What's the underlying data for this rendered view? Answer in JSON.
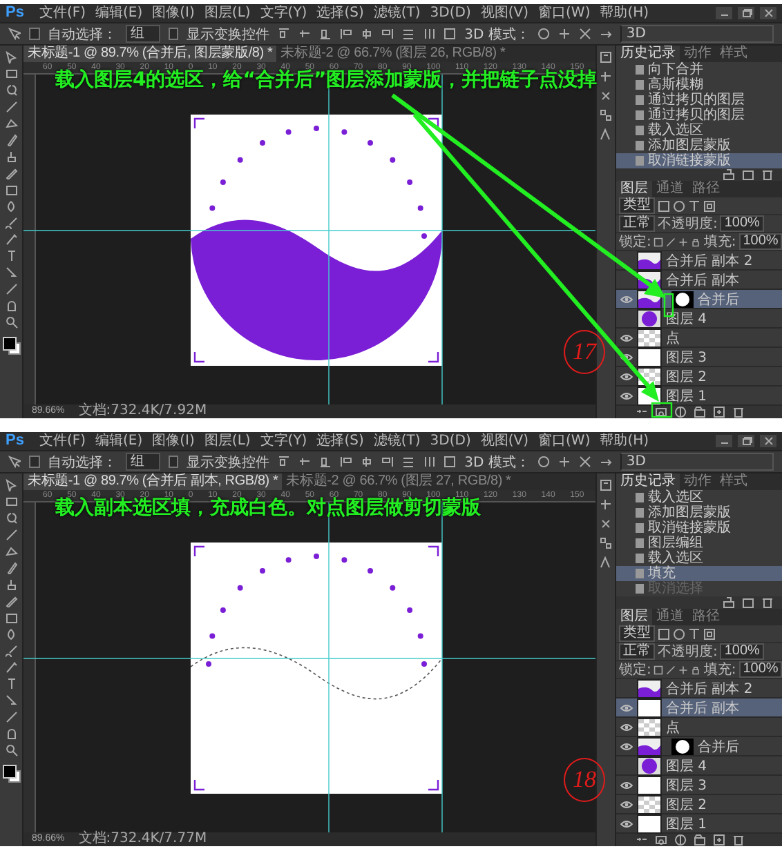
{
  "panels": [
    {
      "menu_bar": {
        "logo": "Ps",
        "items": [
          "文件(F)",
          "编辑(E)",
          "图像(I)",
          "图层(L)",
          "文字(Y)",
          "选择(S)",
          "滤镜(T)",
          "3D(D)",
          "视图(V)",
          "窗口(W)",
          "帮助(H)"
        ]
      },
      "options_bar": {
        "auto_select_label": "自动选择：",
        "auto_select_checked": false,
        "auto_select_value": "组",
        "transform_label": "显示变换控件",
        "transform_checked": false,
        "mode_label": "3D 模式：",
        "mode_value": "3D"
      },
      "document_tabs": [
        {
          "label": "未标题-1 @ 89.7% (合并后, 图层蒙版/8) *",
          "selected": true
        },
        {
          "label": "未标题-2 @ 66.7% (图层 26, RGB/8) *",
          "selected": false
        }
      ],
      "ruler_ticks": [
        "60",
        "50",
        "40",
        "30",
        "20",
        "10",
        "0",
        "10",
        "20",
        "30",
        "40",
        "50",
        "60",
        "70",
        "80",
        "90",
        "100",
        "110",
        "120",
        "130",
        "140",
        "150"
      ],
      "canvas": {
        "kind": "masked-shape"
      },
      "status_bar": {
        "zoom": "89.66%",
        "doc_size": "文档:732.4K/7.92M"
      },
      "history": {
        "tabs": [
          {
            "label": "历史记录",
            "selected": true
          },
          {
            "label": "动作",
            "selected": false
          },
          {
            "label": "样式",
            "selected": false
          }
        ],
        "items": [
          {
            "label": "向下合并",
            "selected": false,
            "disabled": false
          },
          {
            "label": "高斯模糊",
            "selected": false,
            "disabled": false
          },
          {
            "label": "通过拷贝的图层",
            "selected": false,
            "disabled": false
          },
          {
            "label": "通过拷贝的图层",
            "selected": false,
            "disabled": false
          },
          {
            "label": "载入选区",
            "selected": false,
            "disabled": false
          },
          {
            "label": "添加图层蒙版",
            "selected": false,
            "disabled": false
          },
          {
            "label": "取消链接蒙版",
            "selected": true,
            "disabled": false
          }
        ]
      },
      "layers": {
        "tabs": [
          {
            "label": "图层",
            "selected": true
          },
          {
            "label": "通道",
            "selected": false
          },
          {
            "label": "路径",
            "selected": false
          }
        ],
        "filter": "类型",
        "blend_mode": "正常",
        "opacity_label": "不透明度:",
        "opacity": "100%",
        "lock_label": "锁定:",
        "fill_label": "填充:",
        "fill": "100%",
        "items": [
          {
            "name": "合并后 副本 2",
            "kind": "wave",
            "mask": false,
            "visible": false,
            "selected": false
          },
          {
            "name": "合并后 副本",
            "kind": "wave",
            "mask": false,
            "visible": false,
            "selected": false
          },
          {
            "name": "合并后",
            "kind": "wave",
            "mask": true,
            "visible": true,
            "selected": true
          },
          {
            "name": "图层 4",
            "kind": "circle",
            "mask": false,
            "visible": false,
            "selected": false
          },
          {
            "name": "点",
            "kind": "transparent",
            "mask": false,
            "visible": true,
            "selected": false
          },
          {
            "name": "图层 3",
            "kind": "white",
            "mask": false,
            "visible": true,
            "selected": false
          },
          {
            "name": "图层 2",
            "kind": "transparent",
            "mask": false,
            "visible": true,
            "selected": false
          },
          {
            "name": "图层 1",
            "kind": "white",
            "mask": false,
            "visible": true,
            "selected": false
          }
        ]
      },
      "annotation": {
        "text": "载入图层4的选区，给“合并后”图层添加蒙版，并把链子点没掉",
        "step": "17",
        "arrows": true
      }
    },
    {
      "menu_bar": {
        "logo": "Ps",
        "items": [
          "文件(F)",
          "编辑(E)",
          "图像(I)",
          "图层(L)",
          "文字(Y)",
          "选择(S)",
          "滤镜(T)",
          "3D(D)",
          "视图(V)",
          "窗口(W)",
          "帮助(H)"
        ]
      },
      "options_bar": {
        "auto_select_label": "自动选择：",
        "auto_select_checked": false,
        "auto_select_value": "组",
        "transform_label": "显示变换控件",
        "transform_checked": false,
        "mode_label": "3D 模式：",
        "mode_value": "3D"
      },
      "document_tabs": [
        {
          "label": "未标题-1 @ 89.7% (合并后 副本, RGB/8) *",
          "selected": true
        },
        {
          "label": "未标题-2 @ 66.7% (图层 27, RGB/8) *",
          "selected": false
        }
      ],
      "ruler_ticks": [
        "60",
        "50",
        "40",
        "30",
        "20",
        "10",
        "0",
        "10",
        "20",
        "30",
        "40",
        "50",
        "60",
        "70",
        "80",
        "90",
        "100",
        "110",
        "120",
        "130",
        "140",
        "150"
      ],
      "canvas": {
        "kind": "selection-outline"
      },
      "status_bar": {
        "zoom": "89.66%",
        "doc_size": "文档:732.4K/7.77M"
      },
      "history": {
        "tabs": [
          {
            "label": "历史记录",
            "selected": true
          },
          {
            "label": "动作",
            "selected": false
          },
          {
            "label": "样式",
            "selected": false
          }
        ],
        "items": [
          {
            "label": "载入选区",
            "selected": false,
            "disabled": false
          },
          {
            "label": "添加图层蒙版",
            "selected": false,
            "disabled": false
          },
          {
            "label": "取消链接蒙版",
            "selected": false,
            "disabled": false
          },
          {
            "label": "图层编组",
            "selected": false,
            "disabled": false
          },
          {
            "label": "载入选区",
            "selected": false,
            "disabled": false
          },
          {
            "label": "填充",
            "selected": true,
            "disabled": false
          },
          {
            "label": "取消选择",
            "selected": false,
            "disabled": true
          }
        ]
      },
      "layers": {
        "tabs": [
          {
            "label": "图层",
            "selected": true
          },
          {
            "label": "通道",
            "selected": false
          },
          {
            "label": "路径",
            "selected": false
          }
        ],
        "filter": "类型",
        "blend_mode": "正常",
        "opacity_label": "不透明度:",
        "opacity": "100%",
        "lock_label": "锁定:",
        "fill_label": "填充:",
        "fill": "100%",
        "items": [
          {
            "name": "合并后 副本 2",
            "kind": "wave",
            "mask": false,
            "visible": false,
            "selected": false
          },
          {
            "name": "合并后 副本",
            "kind": "white",
            "mask": false,
            "visible": true,
            "selected": true
          },
          {
            "name": "点",
            "kind": "transparent",
            "mask": false,
            "visible": true,
            "selected": false
          },
          {
            "name": "合并后",
            "kind": "wave",
            "mask": true,
            "visible": true,
            "selected": false
          },
          {
            "name": "图层 4",
            "kind": "circle",
            "mask": false,
            "visible": false,
            "selected": false
          },
          {
            "name": "图层 3",
            "kind": "white",
            "mask": false,
            "visible": true,
            "selected": false
          },
          {
            "name": "图层 2",
            "kind": "transparent",
            "mask": false,
            "visible": true,
            "selected": false
          },
          {
            "name": "图层 1",
            "kind": "white",
            "mask": false,
            "visible": true,
            "selected": false
          }
        ]
      },
      "annotation": {
        "text": "载入副本选区填，充成白色。对点图层做剪切蒙版",
        "step": "18"
      }
    }
  ]
}
